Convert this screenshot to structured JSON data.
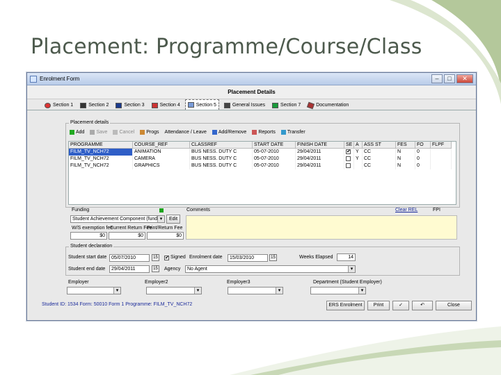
{
  "slide": {
    "title": "Placement: Programme/Course/Class"
  },
  "window": {
    "title": "Enrolment Form",
    "heading": "Placement Details",
    "controls": [
      "–",
      "□",
      "✕"
    ]
  },
  "tabs": [
    {
      "label": "Section 1",
      "icon": "section-1-icon"
    },
    {
      "label": "Section 2",
      "icon": "section-2-icon"
    },
    {
      "label": "Section 3",
      "icon": "section-3-icon"
    },
    {
      "label": "Section 4",
      "icon": "section-4-icon"
    },
    {
      "label": "Section 5",
      "icon": "section-5-icon"
    },
    {
      "label": "General Issues",
      "icon": "general-issues-icon"
    },
    {
      "label": "Section 7",
      "icon": "section-7-icon"
    },
    {
      "label": "Documentation",
      "icon": "documentation-icon"
    }
  ],
  "placement_group_label": "Placement details",
  "toolbar": [
    {
      "label": "Add",
      "disabled": false
    },
    {
      "label": "Save",
      "disabled": true
    },
    {
      "label": "Cancel",
      "disabled": true
    },
    {
      "label": "Progs",
      "disabled": false
    },
    {
      "label": "Attendance / Leave",
      "disabled": false
    },
    {
      "label": "Add/Remove",
      "disabled": false
    },
    {
      "label": "Reports",
      "disabled": false
    },
    {
      "label": "Transfer",
      "disabled": false
    }
  ],
  "grid": {
    "columns": [
      "PROGRAMME",
      "COURSE_REF",
      "CLASSREF",
      "START DATE",
      "FINISH DATE",
      "SE",
      "A",
      "ASS ST",
      "FES",
      "FO",
      "FLPF"
    ],
    "rows": [
      {
        "programme": "FILM_TV_NCH72",
        "course": "ANIMATION",
        "class": "BUS NESS. DUTY C",
        "start": "05-07-2010",
        "finish": "29/04/2011",
        "se": true,
        "a": "Y",
        "ass": "CC",
        "fes": "N",
        "fo": "0",
        "selected": true
      },
      {
        "programme": "FILM_TV_NCH72",
        "course": "CAMERA",
        "class": "BUS NESS. DUTY C",
        "start": "05-07-2010",
        "finish": "29/04/2011",
        "se": false,
        "a": "Y",
        "ass": "CC",
        "fes": "N",
        "fo": "0",
        "selected": false
      },
      {
        "programme": "FILM_TV_NCH72",
        "course": "GRAPHICS",
        "class": "BUS NESS. DUTY C",
        "start": "05-07-2010",
        "finish": "29/04/2011",
        "se": false,
        "a": "",
        "ass": "CC",
        "fes": "N",
        "fo": "0",
        "selected": false
      }
    ]
  },
  "funding": {
    "label": "Funding",
    "value": "Student Achievement Component (fundi",
    "edit_label": "Edit",
    "exemption_label": "W/S exemption fee",
    "exemption_value": "$0",
    "current_fee_label": "Current Return Fee",
    "current_fee_value": "$0",
    "print_fee_label": "Print/Return Fee",
    "print_fee_value": "$0"
  },
  "comments": {
    "label": "Comments",
    "link": "Clear REL",
    "link2": "FPI"
  },
  "declaration": {
    "group_label": "Student declaration",
    "start_label": "Student start date",
    "start_value": "05/07/2010",
    "signed_label": "Signed",
    "enrolment_date_label": "Enrolment date",
    "enrolment_date_value": "15/03/2010",
    "weeks_label": "Weeks Elapsed",
    "weeks_value": "14",
    "end_label": "Student end date",
    "end_value": "29/04/2011",
    "agency_label": "Agency",
    "agency_value": "No Agent"
  },
  "employers": {
    "employer_label": "Employer",
    "employer2_label": "Employer2",
    "employer3_label": "Employer3",
    "department_label": "Department (Student Employer)"
  },
  "status": {
    "text": "Student ID: 1534 Form: 50010 Form 1   Programme: FILM_TV_NCH72"
  },
  "footer_buttons": {
    "ers": "ERS Enrolment",
    "print": "Print",
    "close": "Close"
  }
}
